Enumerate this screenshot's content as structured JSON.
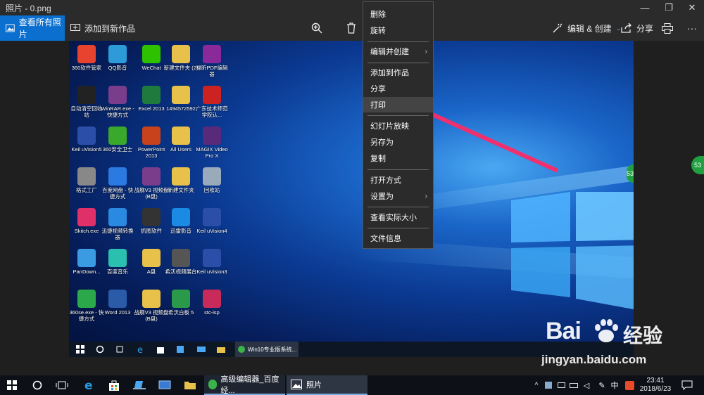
{
  "window": {
    "title": "照片 - 0.png",
    "minimize": "—",
    "maximize": "❐",
    "close": "✕"
  },
  "toolbar": {
    "view_all": "查看所有照片",
    "add_to_album": "添加到新作品",
    "edit_create": "编辑 & 创建",
    "share": "分享",
    "more": "···"
  },
  "context_menu": {
    "items": [
      {
        "label": "删除"
      },
      {
        "label": "旋转"
      },
      {
        "label": "编辑并创建",
        "submenu": true
      },
      {
        "label": "添加到作品"
      },
      {
        "label": "分享"
      },
      {
        "label": "打印",
        "highlighted": true
      },
      {
        "label": "幻灯片放映"
      },
      {
        "label": "另存为"
      },
      {
        "label": "复制"
      },
      {
        "label": "打开方式"
      },
      {
        "label": "设置为",
        "submenu": true
      },
      {
        "label": "查看实际大小"
      },
      {
        "label": "文件信息"
      }
    ],
    "submenu_arrow": "›"
  },
  "desktop_icons": [
    {
      "label": "360软件管家",
      "color": "#e8432f"
    },
    {
      "label": "QQ影音",
      "color": "#2d9bd7"
    },
    {
      "label": "WeChat",
      "color": "#2dc100"
    },
    {
      "label": "新建文件夹 (2)",
      "color": "#e8c14a"
    },
    {
      "label": "福昕PDF编辑器",
      "color": "#8a2a9a"
    },
    {
      "label": "自动清空回收站",
      "color": "#222222"
    },
    {
      "label": "WinRAR.exe - 快捷方式",
      "color": "#7a3d8c"
    },
    {
      "label": "Excel 2013",
      "color": "#1f7a3e"
    },
    {
      "label": "1494572592",
      "color": "#e8c14a"
    },
    {
      "label": "广东技术师范学院认...",
      "color": "#c22"
    },
    {
      "label": "Keil uVision5",
      "color": "#2b4fa8"
    },
    {
      "label": "360安全卫士",
      "color": "#3aa82a"
    },
    {
      "label": "PowerPoint 2013",
      "color": "#c8421c"
    },
    {
      "label": "All Users",
      "color": "#e8c14a"
    },
    {
      "label": "MAGIX Video Pro X",
      "color": "#5a2a7a"
    },
    {
      "label": "格式工厂",
      "color": "#888888"
    },
    {
      "label": "百度网盘 - 快捷方式",
      "color": "#2a7ae2"
    },
    {
      "label": "战舰V3 视频盘(B盘)",
      "color": "#7a3d8c"
    },
    {
      "label": "新建文件夹",
      "color": "#e8c14a"
    },
    {
      "label": "回收站",
      "color": "#9ab"
    },
    {
      "label": "Skitch.exe",
      "color": "#e0306a"
    },
    {
      "label": "迅捷视频转换器",
      "color": "#2a8ae2"
    },
    {
      "label": "抓图软件",
      "color": "#333333"
    },
    {
      "label": "迅雷影音",
      "color": "#1a8ae2"
    },
    {
      "label": "Keil uVision4",
      "color": "#2b4fa8"
    },
    {
      "label": "PanDown...",
      "color": "#3a9ae2"
    },
    {
      "label": "百度音乐",
      "color": "#2abfae"
    },
    {
      "label": "A盘",
      "color": "#e8c14a"
    },
    {
      "label": "希沃视频展台",
      "color": "#555555"
    },
    {
      "label": "Keil uVision3",
      "color": "#2b4fa8"
    },
    {
      "label": "360se.exe - 快捷方式",
      "color": "#2aa84a"
    },
    {
      "label": "Word 2013",
      "color": "#2a5aa8"
    },
    {
      "label": "战舰V3 视频盘(B盘)",
      "color": "#e8c14a"
    },
    {
      "label": "希沃白板 5",
      "color": "#2a9a4a"
    },
    {
      "label": "stc-isp",
      "color": "#c82a5a"
    }
  ],
  "inner_taskbar": {
    "task_label": "Win10专业版系统..."
  },
  "taskbar": {
    "task1": "高级编辑器_百度经...",
    "task2": "照片",
    "ime": "中",
    "time": "23:41",
    "date": "2018/6/23"
  },
  "badges": {
    "right": "53",
    "mid": "53"
  },
  "watermark": {
    "brand": "Bai",
    "brand_cn": "经验",
    "url": "jingyan.baidu.com"
  },
  "colors": {
    "accent": "#0a6fce",
    "arrow": "#f0306e"
  }
}
